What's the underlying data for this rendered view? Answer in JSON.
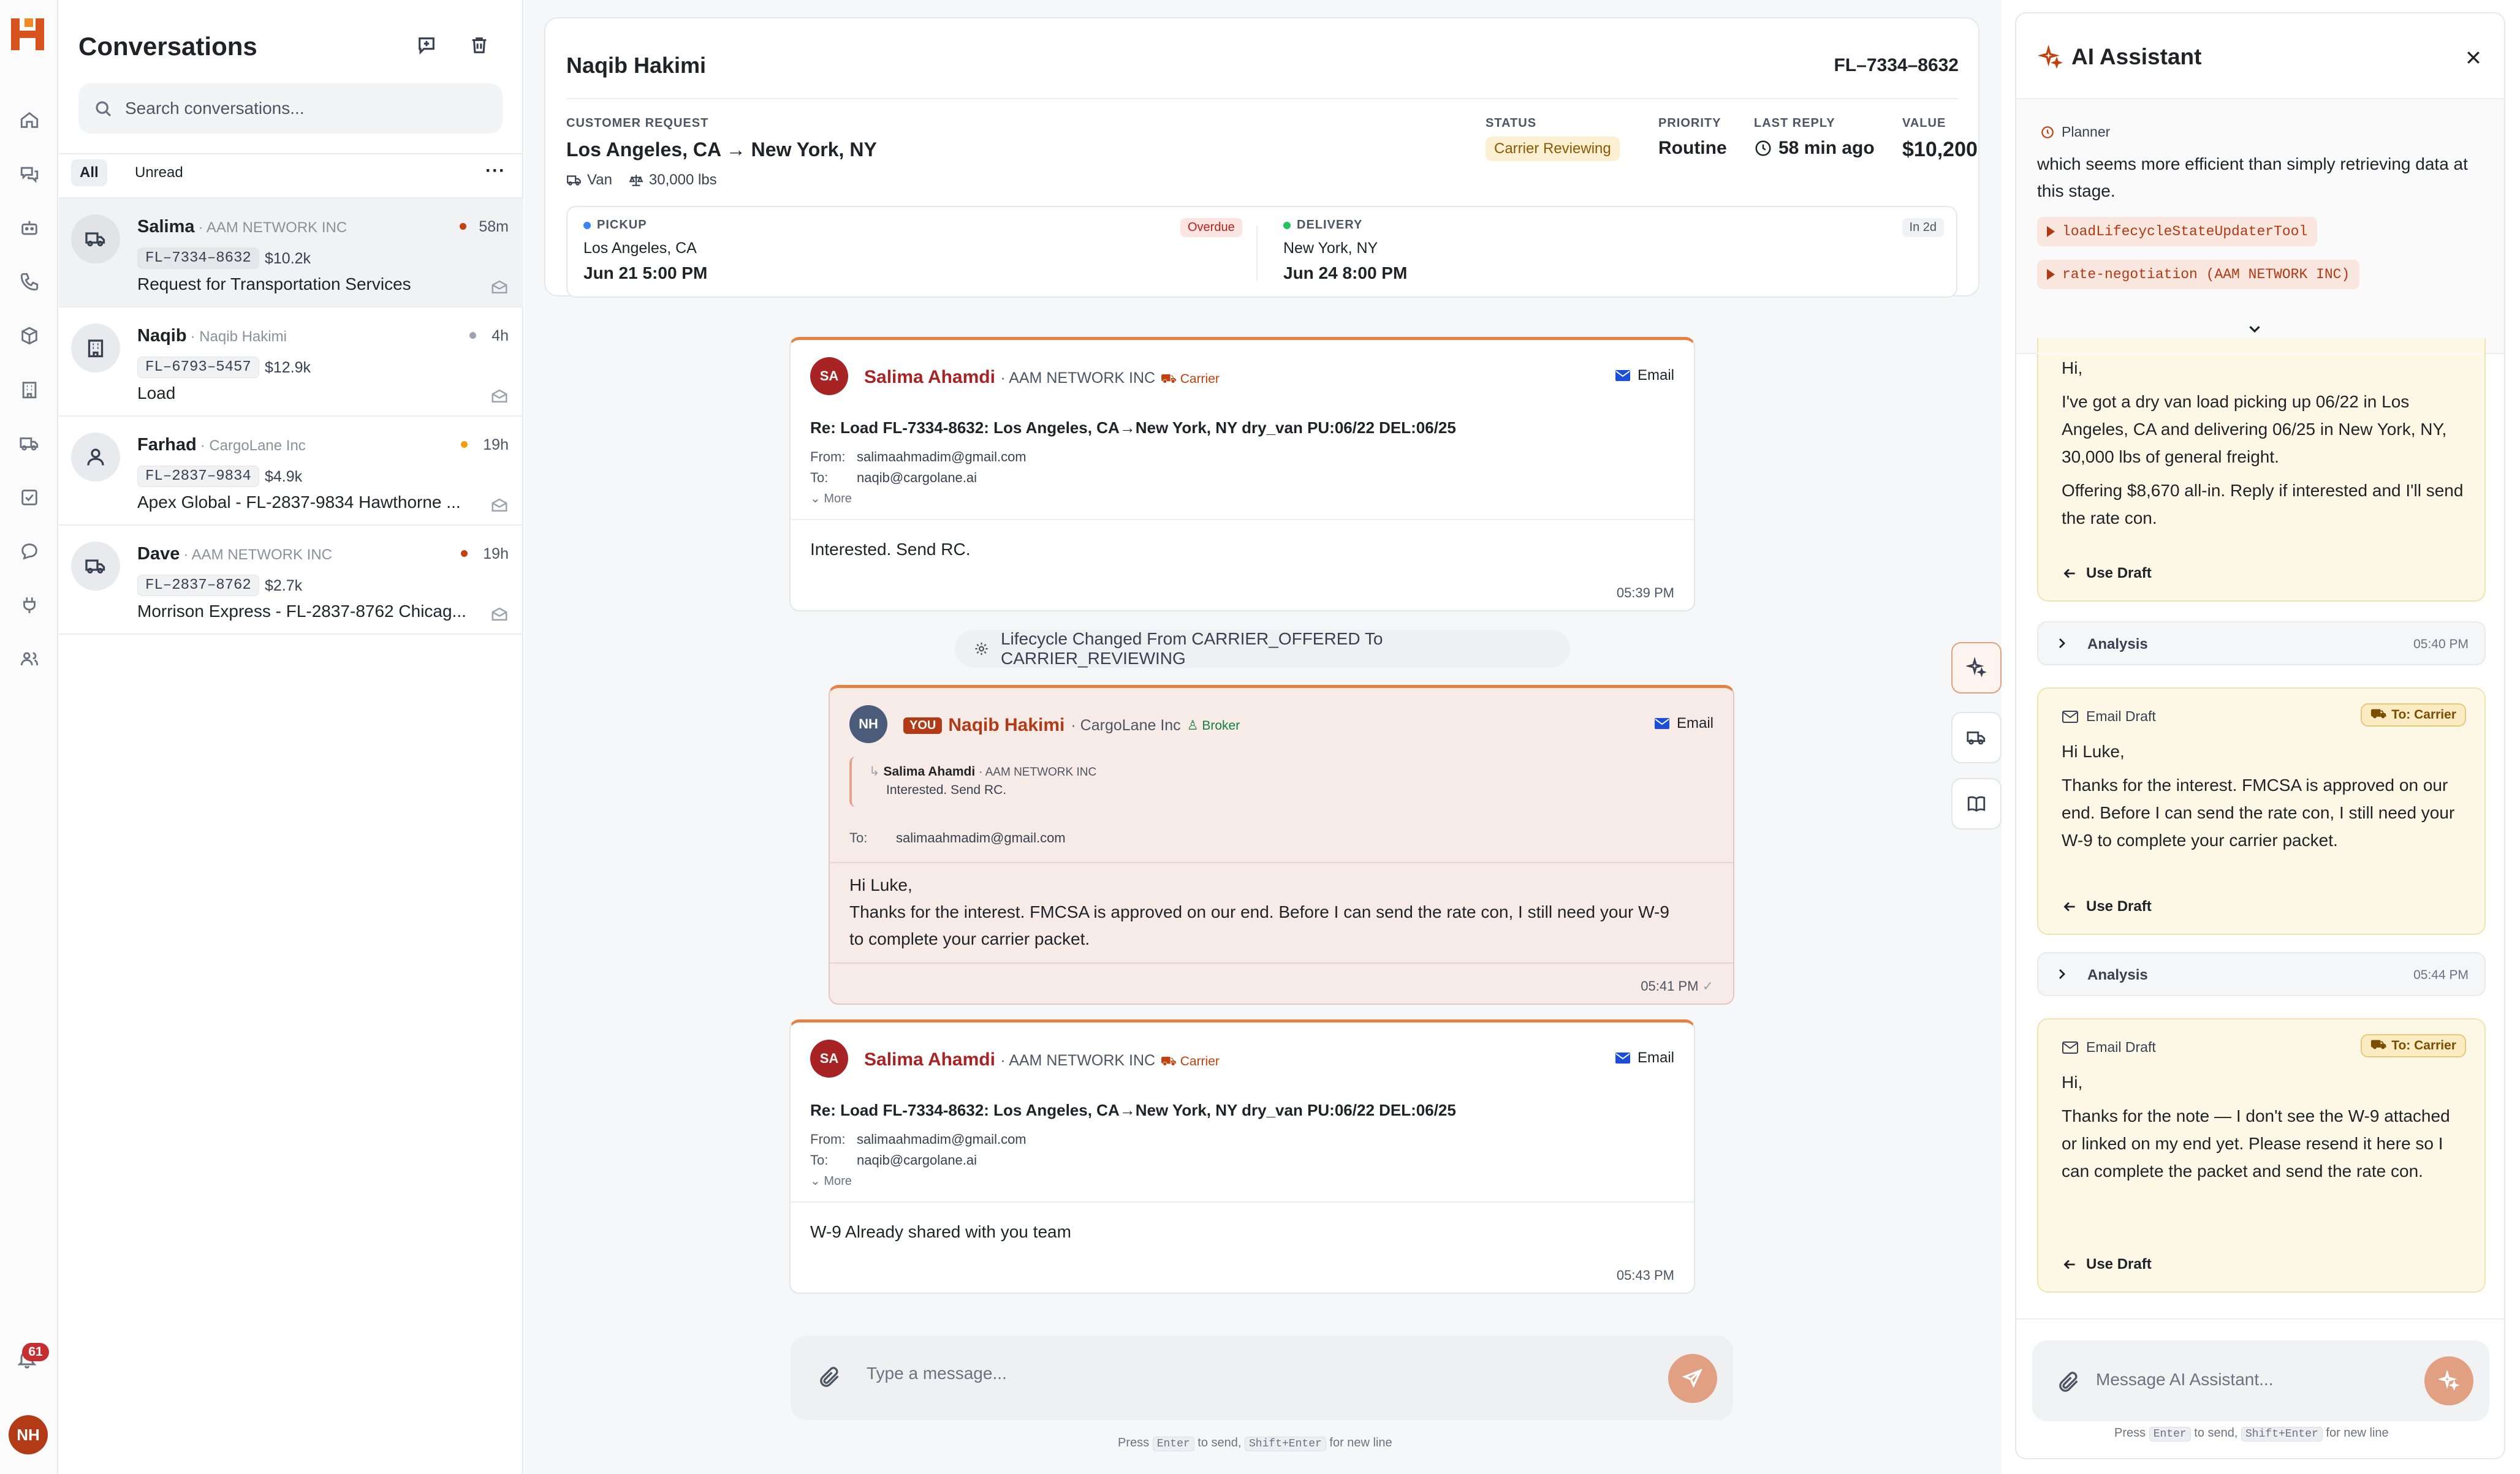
{
  "conversations_panel": {
    "title": "Conversations",
    "search_placeholder": "Search conversations...",
    "filters": [
      "All",
      "Unread"
    ],
    "active_filter": "All",
    "items": [
      {
        "name": "Salima",
        "company": "· AAM NETWORK INC",
        "time": "58m",
        "load": "FL–7334–8632",
        "price": "$10.2k",
        "subject": "Request for Transportation Services",
        "dot_color": "#c2410c",
        "icon": "truck-icon"
      },
      {
        "name": "Naqib",
        "company": "· Naqib Hakimi",
        "time": "4h",
        "load": "FL–6793–5457",
        "price": "$12.9k",
        "subject": "Load",
        "dot_color": "#9ca3af",
        "icon": "building-icon"
      },
      {
        "name": "Farhad",
        "company": "· CargoLane Inc",
        "time": "19h",
        "load": "FL–2837–9834",
        "price": "$4.9k",
        "subject": "Apex Global - FL-2837-9834 Hawthorne ...",
        "dot_color": "#f59e0b",
        "icon": "user-icon"
      },
      {
        "name": "Dave",
        "company": "· AAM NETWORK INC",
        "time": "19h",
        "load": "FL–2837–8762",
        "price": "$2.7k",
        "subject": "Morrison Express - FL-2837-8762 Chicag...",
        "dot_color": "#c2410c",
        "icon": "truck-icon"
      }
    ]
  },
  "rail": {
    "notification_count": "61",
    "user_initials": "NH",
    "icons": [
      "home-icon",
      "chat-icon",
      "bot-icon",
      "phone-icon",
      "package-icon",
      "building-icon",
      "truck-icon",
      "checklist-icon",
      "message-circle-icon",
      "plug-icon",
      "users-icon"
    ]
  },
  "load": {
    "contact_name": "Naqib Hakimi",
    "load_id": "FL–7334–8632",
    "customer_request_label": "CUSTOMER REQUEST",
    "route": "Los Angeles, CA → New York, NY",
    "equipment": "Van",
    "weight": "30,000 lbs",
    "status_label": "STATUS",
    "status": "Carrier Reviewing",
    "priority_label": "PRIORITY",
    "priority": "Routine",
    "last_reply_label": "LAST REPLY",
    "last_reply": "58 min ago",
    "value_label": "VALUE",
    "value": "$10,200",
    "pickup": {
      "label": "PICKUP",
      "city": "Los Angeles, CA",
      "date": "Jun 21  5:00 PM",
      "badge": "Overdue"
    },
    "delivery": {
      "label": "DELIVERY",
      "city": "New York, NY",
      "date": "Jun 24  8:00 PM",
      "badge": "In 2d"
    }
  },
  "messages": [
    {
      "initials": "SA",
      "sender": "Salima Ahamdi",
      "company": "· AAM NETWORK INC",
      "role": "Carrier",
      "channel": "Email",
      "subject": "Re: Load FL-7334-8632: Los Angeles, CA→New York, NY dry_van PU:06/22 DEL:06/25",
      "from_label": "From:",
      "from": "salimaahmadim@gmail.com",
      "to_label": "To:",
      "to": "naqib@cargolane.ai",
      "more": "More",
      "body": "Interested. Send RC.",
      "time": "05:39 PM"
    },
    {
      "initials": "NH",
      "you": "YOU",
      "sender": "Naqib Hakimi",
      "company": "· CargoLane Inc",
      "role": "Broker",
      "channel": "Email",
      "quote_sender": "Salima Ahamdi",
      "quote_company": "· AAM NETWORK INC",
      "quote_text": "Interested. Send RC.",
      "to_label": "To:",
      "to": "salimaahmadim@gmail.com",
      "body_lines": [
        "Hi Luke,",
        "Thanks for the interest. FMCSA is approved on our end. Before I can send the rate con, I still need your W-9",
        "to complete your carrier packet."
      ],
      "time": "05:41 PM"
    },
    {
      "initials": "SA",
      "sender": "Salima Ahamdi",
      "company": "· AAM NETWORK INC",
      "role": "Carrier",
      "channel": "Email",
      "subject": "Re: Load FL-7334-8632: Los Angeles, CA→New York, NY dry_van PU:06/22 DEL:06/25",
      "from_label": "From:",
      "from": "salimaahmadim@gmail.com",
      "to_label": "To:",
      "to": "naqib@cargolane.ai",
      "more": "More",
      "body": "W-9 Already shared with you team",
      "time": "05:43 PM"
    }
  ],
  "lifecycle_event": "Lifecycle Changed From CARRIER_OFFERED To CARRIER_REVIEWING",
  "composer": {
    "placeholder": "Type a message...",
    "hint_press": "Press",
    "hint_enter": "Enter",
    "hint_send": "to send,",
    "hint_shift": "Shift+Enter",
    "hint_newline": "for new line"
  },
  "ai_panel": {
    "title": "AI Assistant",
    "planner_label": "Planner",
    "planner_text": "which seems more efficient than simply retrieving data at this stage.",
    "tools": [
      "loadLifecycleStateUpdaterTool",
      "rate-negotiation (AAM NETWORK INC)"
    ],
    "draft1_lines": [
      "Hi,",
      "I've got a dry van load picking up 06/22 in Los Angeles, CA and delivering 06/25 in New York, NY, 30,000 lbs of general freight.",
      "Offering $8,670 all-in. Reply if interested and I'll send the rate con."
    ],
    "use_draft": "Use Draft",
    "analysis_label": "Analysis",
    "analysis1_time": "05:40 PM",
    "analysis2_time": "05:44 PM",
    "email_draft_label": "Email Draft",
    "to_carrier": "To: Carrier",
    "draft2_lines": [
      "Hi Luke,",
      "Thanks for the interest. FMCSA is approved on our end. Before I can send the rate con, I still need your W-9 to complete your carrier packet."
    ],
    "draft3_lines": [
      "Hi,",
      "Thanks for the note — I don't see the W-9 attached or linked on my end yet. Please resend it here so I can complete the packet and send the rate con."
    ],
    "composer_placeholder": "Message AI Assistant...",
    "hint_press": "Press",
    "hint_enter": "Enter",
    "hint_send": "to send,",
    "hint_shift": "Shift+Enter",
    "hint_newline": "for new line"
  },
  "colors": {
    "accent": "#e8803f",
    "brand": "#c2410c",
    "carrier_red": "#a82424",
    "draft_bg": "#fdf8e6"
  }
}
